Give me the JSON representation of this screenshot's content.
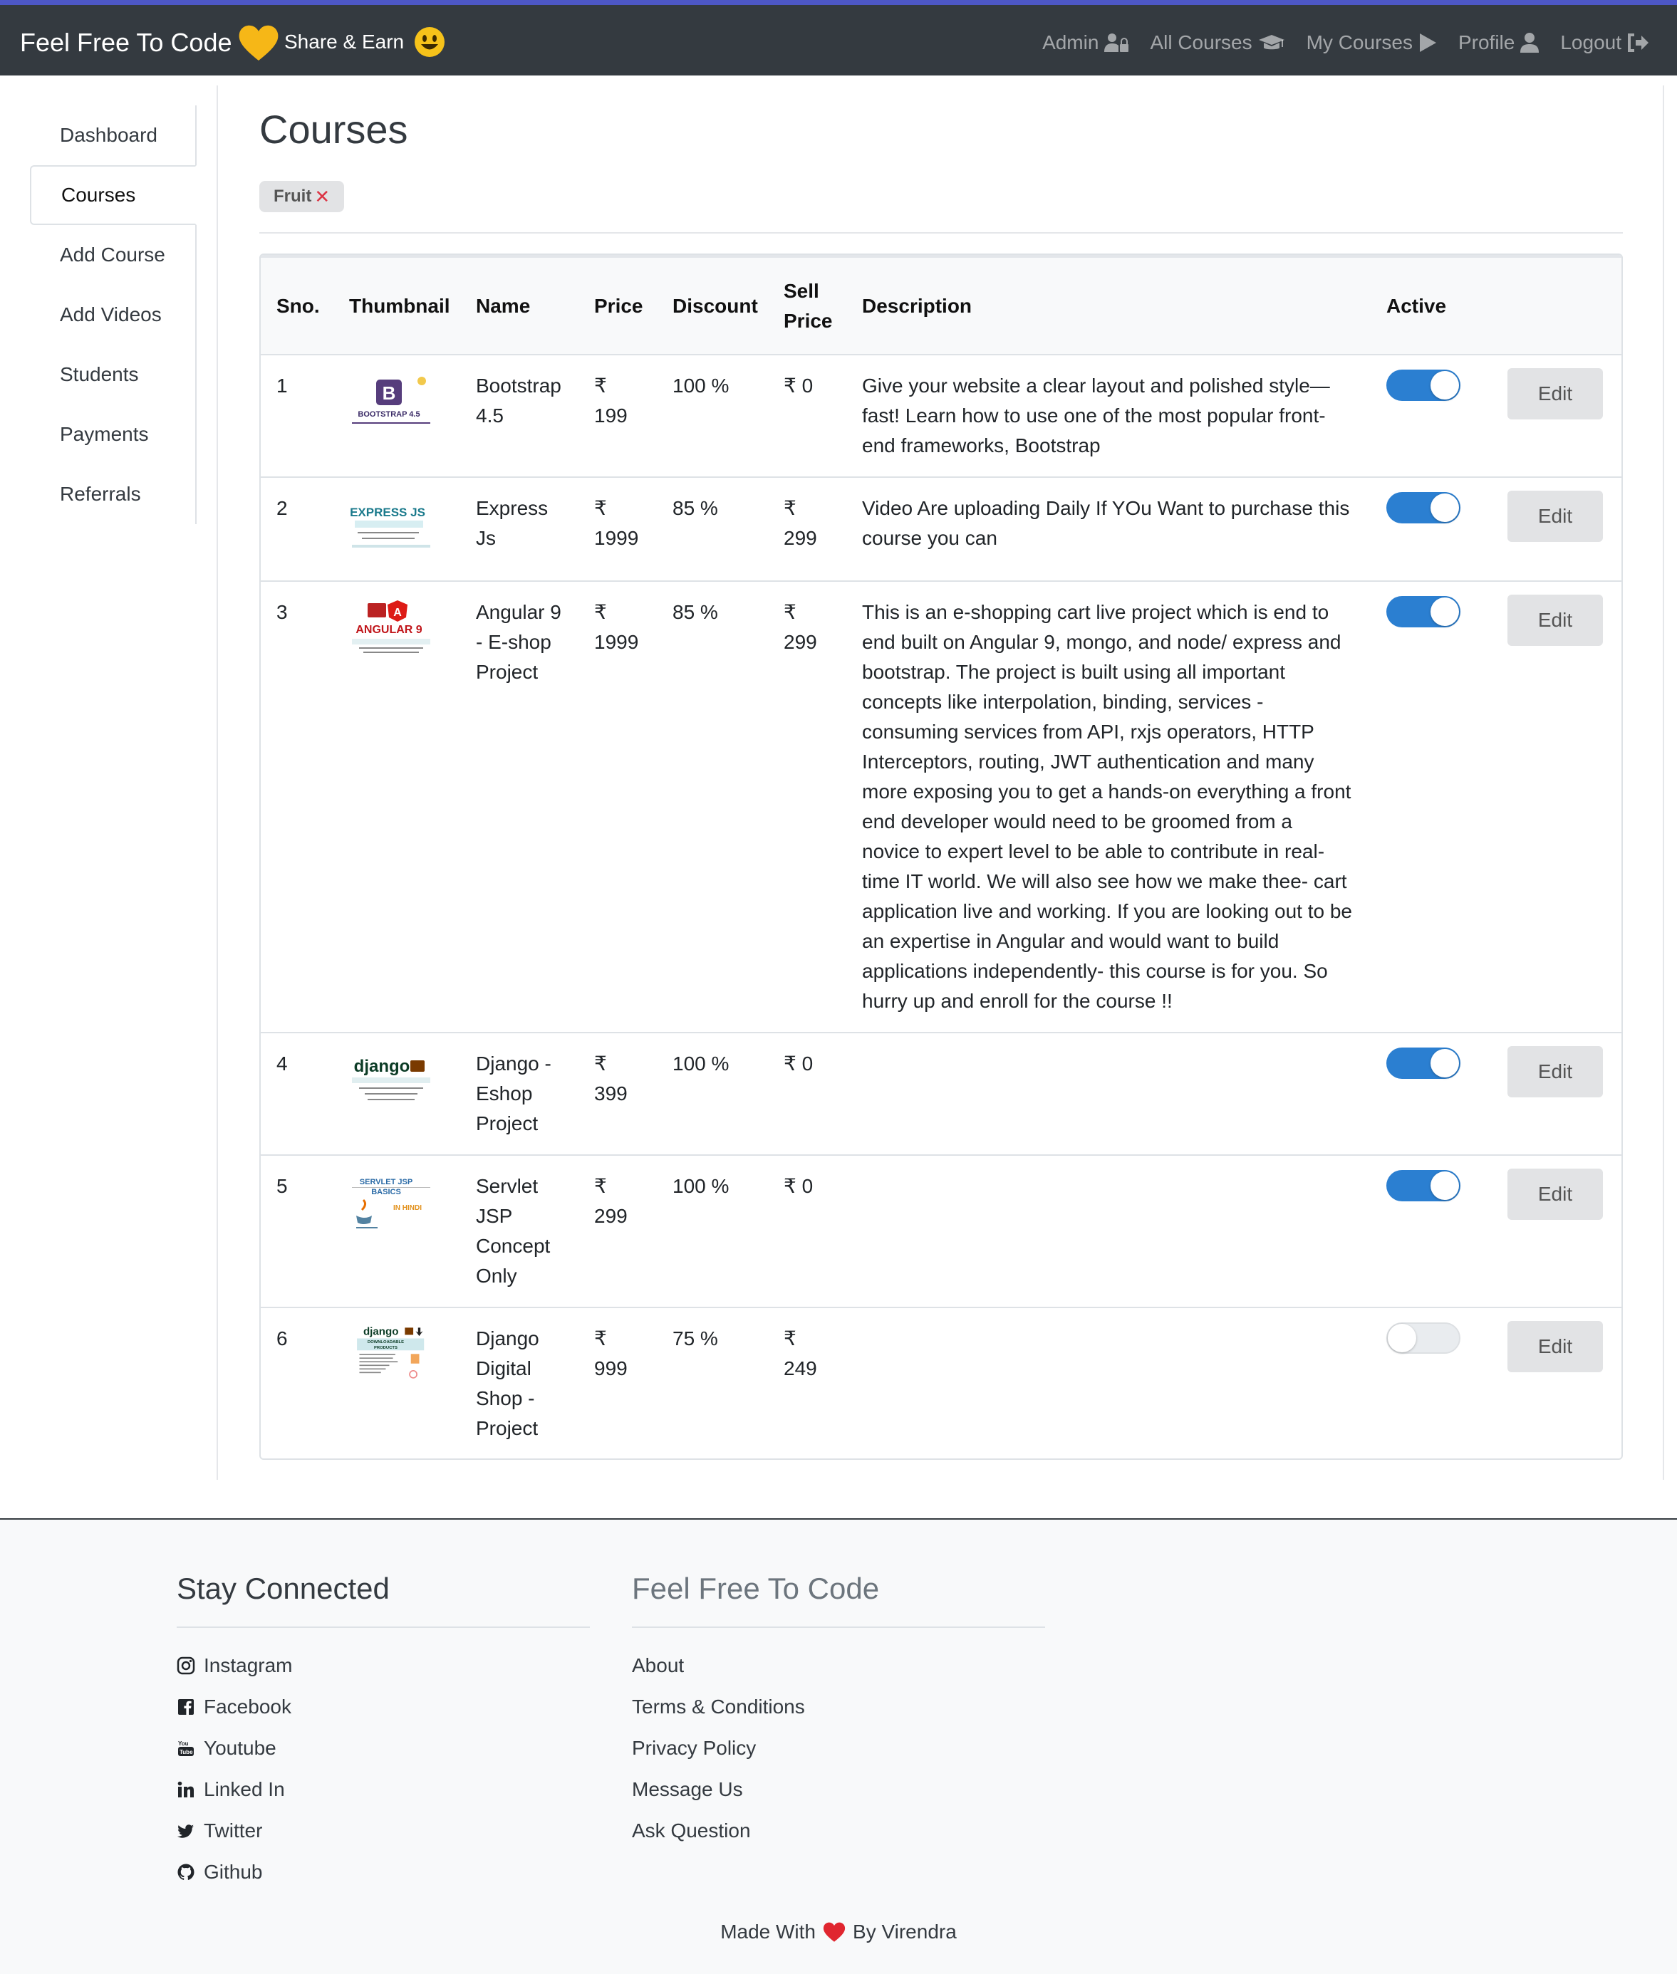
{
  "navbar": {
    "brand": "Feel Free To Code",
    "share": "Share & Earn",
    "links": [
      {
        "label": "Admin",
        "icon": "user-lock-icon"
      },
      {
        "label": "All Courses",
        "icon": "graduation-cap-icon"
      },
      {
        "label": "My Courses",
        "icon": "play-icon"
      },
      {
        "label": "Profile",
        "icon": "user-icon"
      },
      {
        "label": "Logout",
        "icon": "sign-out-icon"
      }
    ],
    "accent": "#4d57c6"
  },
  "sidebar": {
    "items": [
      {
        "label": "Dashboard"
      },
      {
        "label": "Courses",
        "active": true
      },
      {
        "label": "Add Course"
      },
      {
        "label": "Add Videos"
      },
      {
        "label": "Students"
      },
      {
        "label": "Payments"
      },
      {
        "label": "Referrals"
      }
    ]
  },
  "main": {
    "title": "Courses",
    "filter": "Fruit",
    "table": {
      "headers": [
        "Sno.",
        "Thumbnail",
        "Name",
        "Price",
        "Discount",
        "Sell Price",
        "Description",
        "Active",
        ""
      ],
      "rows": [
        {
          "sno": "1",
          "thumb": "bootstrap-thumbnail",
          "thumb_text": "BOOTSTRAP 4.5",
          "name": "Bootstrap 4.5",
          "price": "₹ 199",
          "discount": "100 %",
          "sell": "₹ 0",
          "description": "Give your website a clear layout and polished style—fast! Learn how to use one of the most popular front-end frameworks, Bootstrap",
          "active": true,
          "edit": "Edit"
        },
        {
          "sno": "2",
          "thumb": "expressjs-thumbnail",
          "thumb_text": "EXPRESS JS",
          "name": "Express Js",
          "price": "₹ 1999",
          "discount": "85 %",
          "sell": "₹ 299",
          "description": "Video Are uploading Daily If YOu Want to purchase this course you can",
          "active": true,
          "edit": "Edit"
        },
        {
          "sno": "3",
          "thumb": "angular-thumbnail",
          "thumb_text": "ANGULAR 9",
          "name": "Angular 9 - E-shop Project",
          "price": "₹ 1999",
          "discount": "85 %",
          "sell": "₹ 299",
          "description": "This is an e-shopping cart live project which is end to end built on Angular 9, mongo, and node/ express and bootstrap. The project is built using all important concepts like interpolation, binding, services - consuming services from API, rxjs operators, HTTP Interceptors, routing, JWT authentication and many more exposing you to get a hands-on everything a front end developer would need to be groomed from a novice to expert level to be able to contribute in real-time IT world. We will also see how we make thee- cart application live and working. If you are looking out to be an expertise in Angular and would want to build applications independently- this course is for you. So hurry up and enroll for the course !!",
          "active": true,
          "edit": "Edit"
        },
        {
          "sno": "4",
          "thumb": "django-thumbnail",
          "thumb_text": "django",
          "name": "Django - Eshop Project",
          "price": "₹ 399",
          "discount": "100 %",
          "sell": "₹ 0",
          "description": "",
          "active": true,
          "edit": "Edit"
        },
        {
          "sno": "5",
          "thumb": "servlet-jsp-thumbnail",
          "thumb_text": "SERVLET JSP BASICS",
          "name": "Servlet JSP Concept Only",
          "price": "₹ 299",
          "discount": "100 %",
          "sell": "₹ 0",
          "description": "",
          "active": true,
          "edit": "Edit"
        },
        {
          "sno": "6",
          "thumb": "django-digital-thumbnail",
          "thumb_text": "django",
          "name": "Django Digital Shop - Project",
          "price": "₹ 999",
          "discount": "75 %",
          "sell": "₹ 249",
          "description": "",
          "active": false,
          "edit": "Edit"
        }
      ]
    }
  },
  "footer": {
    "left_title": "Stay Connected",
    "right_title": "Feel Free To Code",
    "social": [
      {
        "label": "Instagram",
        "icon": "instagram-icon"
      },
      {
        "label": "Facebook",
        "icon": "facebook-icon"
      },
      {
        "label": "Youtube",
        "icon": "youtube-icon"
      },
      {
        "label": "Linked In",
        "icon": "linkedin-icon"
      },
      {
        "label": "Twitter",
        "icon": "twitter-icon"
      },
      {
        "label": "Github",
        "icon": "github-icon"
      }
    ],
    "links": [
      {
        "label": "About"
      },
      {
        "label": "Terms & Conditions"
      },
      {
        "label": "Privacy Policy"
      },
      {
        "label": "Message Us"
      },
      {
        "label": "Ask Question"
      }
    ],
    "made_with_pre": "Made With",
    "made_with_post": "By Virendra"
  }
}
